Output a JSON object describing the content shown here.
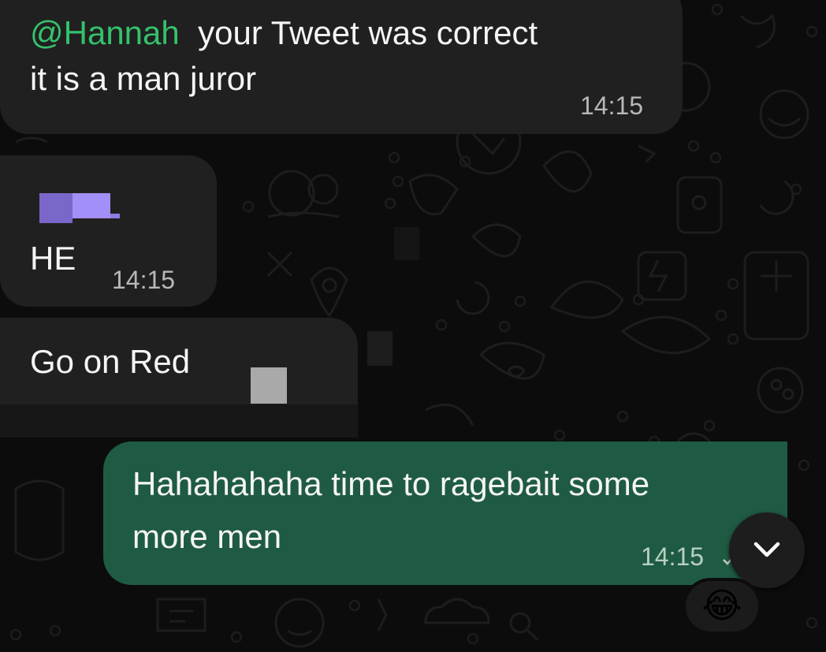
{
  "messages": [
    {
      "id": "m1",
      "direction": "incoming",
      "mention": "@Hannah",
      "text_after_mention": "  your Tweet was correct",
      "text_line2": "it is a man juror",
      "time": "14:15"
    },
    {
      "id": "m2",
      "direction": "incoming",
      "text": "HE",
      "time": "14:15"
    },
    {
      "id": "m3",
      "direction": "incoming",
      "text": "Go on Red"
    },
    {
      "id": "m4",
      "direction": "outgoing",
      "text_line1": "Hahahahaha time to ragebait some",
      "text_line2": "more men",
      "time": "14:15",
      "reaction": "😂"
    }
  ],
  "scroll_button": {
    "icon": "chevron-down-icon"
  },
  "colors": {
    "background": "#0c0c0c",
    "incoming_bubble": "#202020",
    "outgoing_bubble": "#1f5b43",
    "mention": "#35c16c",
    "timestamp": "#b8b8b8",
    "redaction_purple": "#a48ef7"
  }
}
